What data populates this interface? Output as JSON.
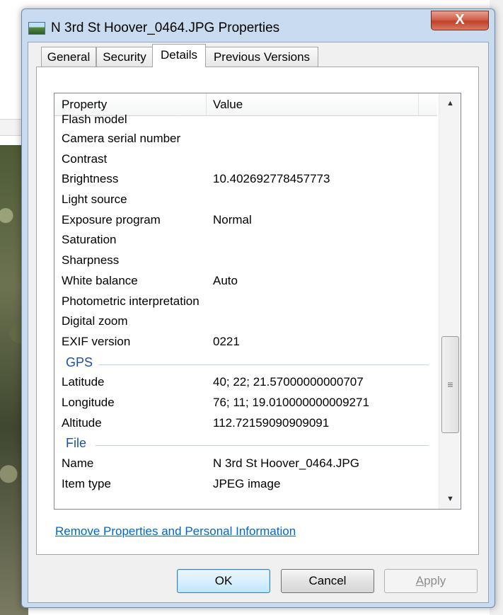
{
  "window": {
    "title": "N 3rd St Hoover_0464.JPG Properties",
    "close_label": "X"
  },
  "tabs": [
    {
      "label": "General"
    },
    {
      "label": "Security"
    },
    {
      "label": "Details"
    },
    {
      "label": "Previous Versions"
    }
  ],
  "active_tab": "Details",
  "columns": {
    "property": "Property",
    "value": "Value"
  },
  "rows": [
    {
      "property": "Flash model",
      "value": ""
    },
    {
      "property": "Camera serial number",
      "value": ""
    },
    {
      "property": "Contrast",
      "value": ""
    },
    {
      "property": "Brightness",
      "value": "10.402692778457773"
    },
    {
      "property": "Light source",
      "value": ""
    },
    {
      "property": "Exposure program",
      "value": "Normal"
    },
    {
      "property": "Saturation",
      "value": ""
    },
    {
      "property": "Sharpness",
      "value": ""
    },
    {
      "property": "White balance",
      "value": "Auto"
    },
    {
      "property": "Photometric interpretation",
      "value": ""
    },
    {
      "property": "Digital zoom",
      "value": ""
    },
    {
      "property": "EXIF version",
      "value": "0221"
    }
  ],
  "gps": {
    "group_label": "GPS",
    "rows": [
      {
        "property": "Latitude",
        "value": "40; 22; 21.57000000000707"
      },
      {
        "property": "Longitude",
        "value": "76; 11; 19.010000000009271"
      },
      {
        "property": "Altitude",
        "value": "112.72159090909091"
      }
    ]
  },
  "file": {
    "group_label": "File",
    "rows": [
      {
        "property": "Name",
        "value": "N 3rd St Hoover_0464.JPG"
      },
      {
        "property": "Item type",
        "value": "JPEG image"
      }
    ]
  },
  "scrollbar": {
    "up": "▲",
    "down": "▼",
    "grip": "≡"
  },
  "link": "Remove Properties and Personal Information",
  "buttons": {
    "ok": "OK",
    "cancel": "Cancel",
    "apply_first": "A",
    "apply_rest": "pply"
  }
}
